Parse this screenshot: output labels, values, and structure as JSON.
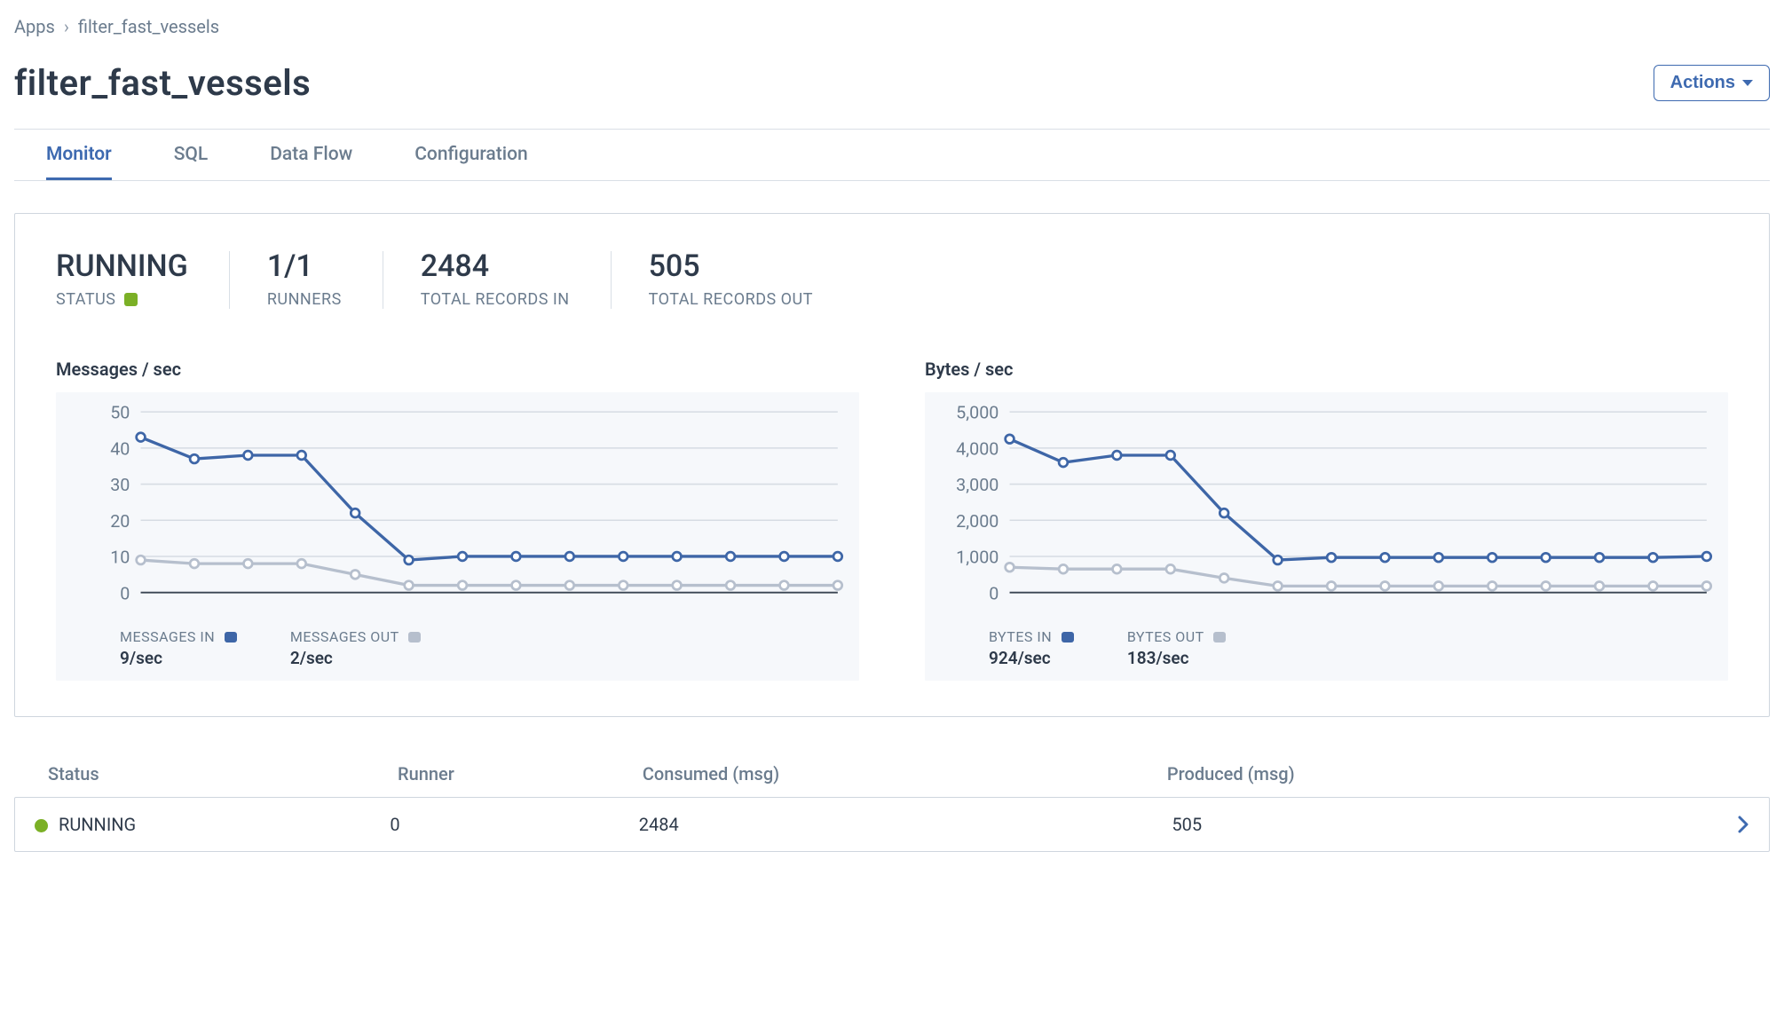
{
  "breadcrumbs": {
    "root": "Apps",
    "current": "filter_fast_vessels"
  },
  "header": {
    "title": "filter_fast_vessels",
    "actions_label": "Actions"
  },
  "tabs": [
    {
      "label": "Monitor",
      "active": true
    },
    {
      "label": "SQL",
      "active": false
    },
    {
      "label": "Data Flow",
      "active": false
    },
    {
      "label": "Configuration",
      "active": false
    }
  ],
  "metrics": {
    "status": {
      "value": "RUNNING",
      "label": "STATUS"
    },
    "runners": {
      "value": "1/1",
      "label": "RUNNERS"
    },
    "total_in": {
      "value": "2484",
      "label": "TOTAL RECORDS IN"
    },
    "total_out": {
      "value": "505",
      "label": "TOTAL RECORDS OUT"
    }
  },
  "charts": {
    "messages": {
      "title": "Messages / sec",
      "legend_in": {
        "label": "MESSAGES IN",
        "value": "9/sec"
      },
      "legend_out": {
        "label": "MESSAGES OUT",
        "value": "2/sec"
      }
    },
    "bytes": {
      "title": "Bytes / sec",
      "legend_in": {
        "label": "BYTES IN",
        "value": "924/sec"
      },
      "legend_out": {
        "label": "BYTES OUT",
        "value": "183/sec"
      }
    }
  },
  "chart_data": [
    {
      "type": "line",
      "title": "Messages / sec",
      "ylabel": "",
      "xlabel": "",
      "ylim": [
        0,
        50
      ],
      "yticks": [
        0,
        10,
        20,
        30,
        40,
        50
      ],
      "x": [
        0,
        1,
        2,
        3,
        4,
        5,
        6,
        7,
        8,
        9,
        10,
        11,
        12,
        13
      ],
      "series": [
        {
          "name": "MESSAGES IN",
          "color": "#3e66a7",
          "values": [
            43,
            37,
            38,
            38,
            22,
            9,
            10,
            10,
            10,
            10,
            10,
            10,
            10,
            10
          ]
        },
        {
          "name": "MESSAGES OUT",
          "color": "#b6bfcd",
          "values": [
            9,
            8,
            8,
            8,
            5,
            2,
            2,
            2,
            2,
            2,
            2,
            2,
            2,
            2
          ]
        }
      ]
    },
    {
      "type": "line",
      "title": "Bytes / sec",
      "ylabel": "",
      "xlabel": "",
      "ylim": [
        0,
        5000
      ],
      "yticks": [
        0,
        1000,
        2000,
        3000,
        4000,
        5000
      ],
      "series": [
        {
          "name": "BYTES IN",
          "color": "#3e66a7",
          "values": [
            4250,
            3600,
            3800,
            3800,
            2200,
            900,
            970,
            970,
            970,
            970,
            970,
            970,
            970,
            1000
          ]
        },
        {
          "name": "BYTES OUT",
          "color": "#b6bfcd",
          "values": [
            700,
            650,
            650,
            650,
            400,
            180,
            180,
            180,
            180,
            180,
            180,
            180,
            180,
            180
          ]
        }
      ]
    }
  ],
  "table": {
    "headers": {
      "status": "Status",
      "runner": "Runner",
      "consumed": "Consumed (msg)",
      "produced": "Produced (msg)"
    },
    "rows": [
      {
        "status": "RUNNING",
        "runner": "0",
        "consumed": "2484",
        "produced": "505"
      }
    ]
  },
  "colors": {
    "series_in": "#3e66a7",
    "series_out": "#b6bfcd",
    "green": "#7bb026",
    "accent": "#3e6ab0"
  }
}
